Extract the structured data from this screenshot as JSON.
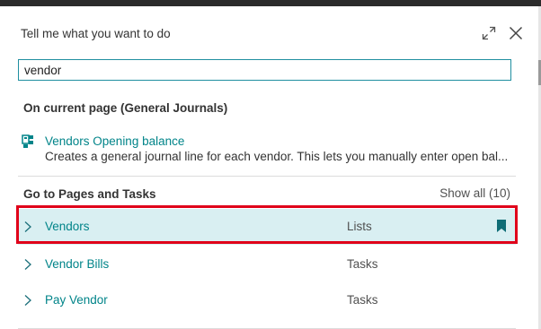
{
  "dialog": {
    "title": "Tell me what you want to do",
    "expand_icon": "expand-icon",
    "close_icon": "close-icon"
  },
  "search": {
    "value": "vendor",
    "placeholder": ""
  },
  "current_page": {
    "heading": "On current page (General Journals)",
    "result": {
      "icon": "journal-action-icon",
      "title": "Vendors Opening balance",
      "description": "Creates a general journal line for each vendor. This lets you manually enter open bal..."
    }
  },
  "pages_tasks": {
    "heading": "Go to Pages and Tasks",
    "show_all": "Show all (10)",
    "rows": [
      {
        "name": "Vendors",
        "category": "Lists",
        "selected": true,
        "bookmarked": true
      },
      {
        "name": "Vendor Bills",
        "category": "Tasks",
        "selected": false,
        "bookmarked": false
      },
      {
        "name": "Pay Vendor",
        "category": "Tasks",
        "selected": false,
        "bookmarked": false
      }
    ]
  },
  "colors": {
    "accent": "#008489",
    "selected_row": "#d9eff2",
    "highlight_box": "#e0001a"
  }
}
